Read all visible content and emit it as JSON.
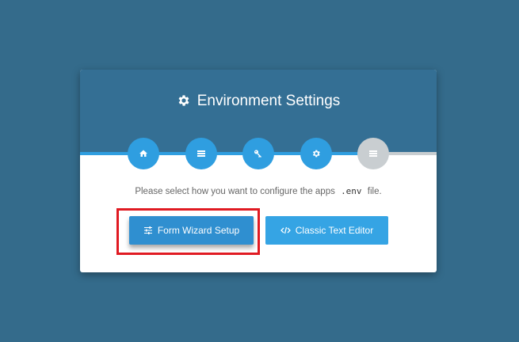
{
  "header": {
    "title": "Environment Settings",
    "title_icon": "gear-icon"
  },
  "steps": [
    {
      "icon": "home-icon",
      "state": "active"
    },
    {
      "icon": "list-icon",
      "state": "active"
    },
    {
      "icon": "key-icon",
      "state": "active"
    },
    {
      "icon": "gear-icon",
      "state": "active"
    },
    {
      "icon": "list-icon",
      "state": "inactive"
    }
  ],
  "message": {
    "prefix": "Please select how you want to configure the apps",
    "code": ".env",
    "suffix": "file."
  },
  "buttons": {
    "form_wizard": {
      "label": "Form Wizard Setup",
      "icon": "sliders-icon"
    },
    "classic_editor": {
      "label": "Classic Text Editor",
      "icon": "code-icon"
    }
  },
  "colors": {
    "background": "#346b8b",
    "header": "#346f94",
    "accent": "#2f9ee0",
    "inactive": "#c9ced1",
    "highlight": "#e01a22"
  }
}
